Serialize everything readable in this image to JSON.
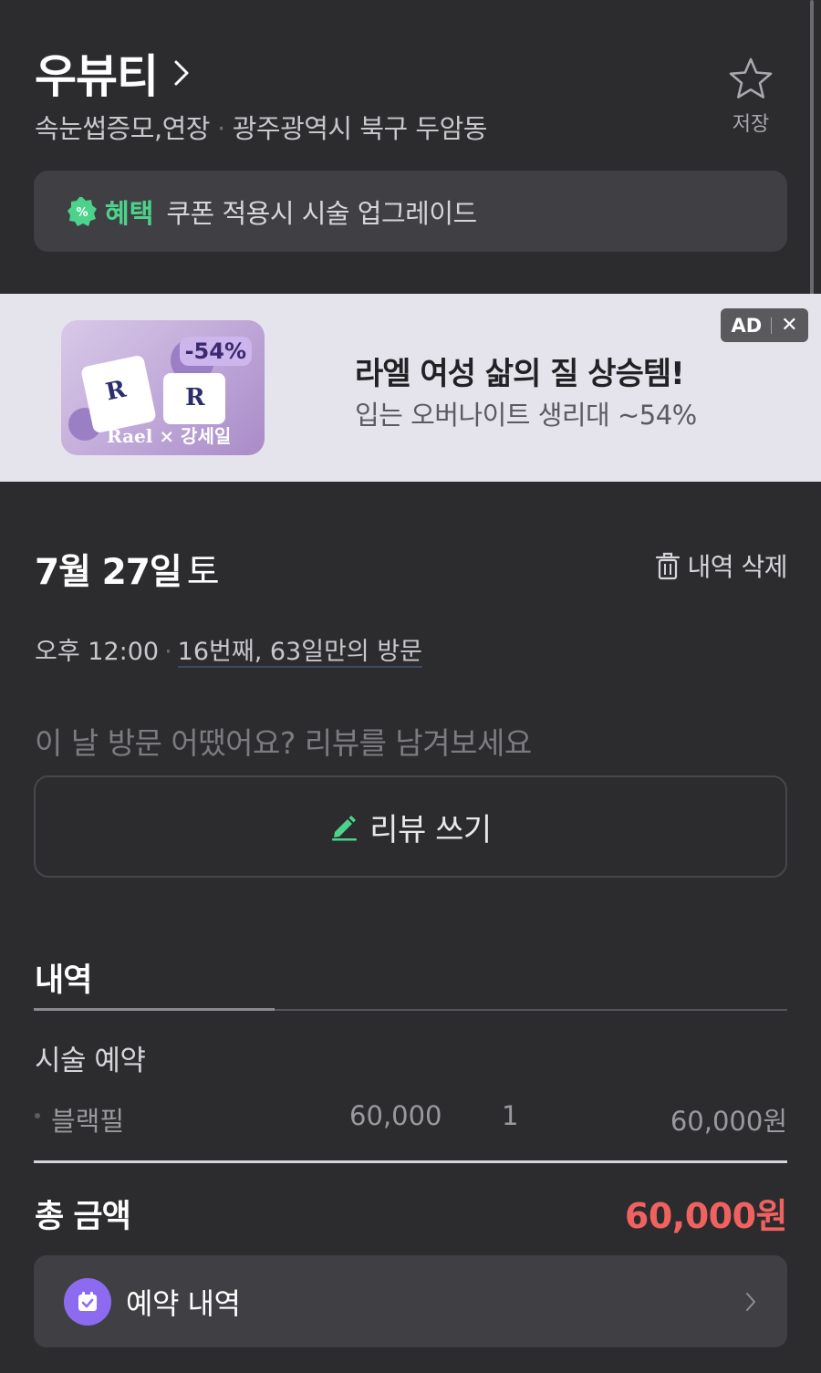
{
  "shop": {
    "name": "우뷰티",
    "category": "속눈썹증모,연장",
    "location": "광주광역시 북구 두암동",
    "save_label": "저장"
  },
  "benefit": {
    "badge_icon": "percent-badge-icon",
    "label": "혜택",
    "text": "쿠폰 적용시 시술 업그레이드"
  },
  "ad": {
    "title": "라엘 여성 삶의 질 상승템!",
    "subtitle": "입는 오버나이트 생리대 ~54%",
    "tag_label": "AD",
    "image_badge": "-54%",
    "image_brand": "Rael × 강세일"
  },
  "visit": {
    "date": "7월 27일",
    "day": "토",
    "delete_label": "내역 삭제",
    "time": "오후 12:00",
    "count_text": "16번째, 63일만의 방문",
    "review_prompt": "이 날 방문 어땠어요? 리뷰를 남겨보세요",
    "review_button_label": "리뷰 쓰기"
  },
  "details": {
    "tab_label": "내역",
    "section_label": "시술 예약",
    "items": [
      {
        "name": "블랙필",
        "price": "60,000",
        "qty": "1",
        "total": "60,000원"
      }
    ],
    "total_label": "총 금액",
    "total_value": "60,000원"
  },
  "reservation": {
    "label": "예약 내역"
  },
  "colors": {
    "background": "#2c2c2e",
    "card": "#404044",
    "benefit_green": "#4cd38b",
    "total_red": "#f0625f",
    "reservation_purple": "#8c6bf1",
    "ad_background": "#e5e4ec"
  }
}
